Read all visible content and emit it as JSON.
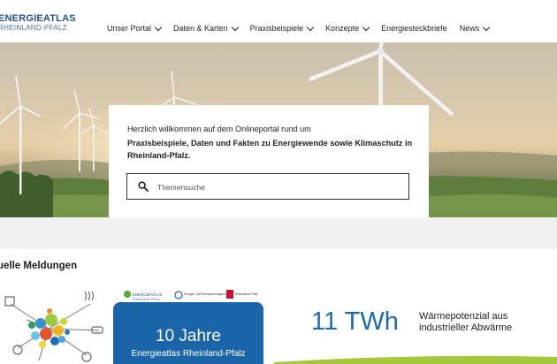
{
  "logo": {
    "line1": "ENERGIEATLAS",
    "line2": "RHEINLAND-PFALZ"
  },
  "nav": [
    {
      "label": "Unser Portal",
      "has_dropdown": true
    },
    {
      "label": "Daten & Karten",
      "has_dropdown": true
    },
    {
      "label": "Praxisbeispiele",
      "has_dropdown": true
    },
    {
      "label": "Konzepte",
      "has_dropdown": true
    },
    {
      "label": "Energiesteckbriefe",
      "has_dropdown": false
    },
    {
      "label": "News",
      "has_dropdown": true
    }
  ],
  "hero": {
    "welcome_line": "Herzlich willkommen auf dem Onlineportal rund um",
    "welcome_bold": "Praxisbeispiele, Daten und Fakten zu Energiewende sowie Klimaschutz in Rheinland-Pfalz.",
    "search": {
      "placeholder": "Themensuche",
      "icon": "search-icon"
    }
  },
  "news": {
    "heading": "uelle Meldungen",
    "cards": [
      {
        "kind": "illustration"
      },
      {
        "kind": "anniversary",
        "title": "10 Jahre",
        "subtitle": "Energieatlas Rheinland-Pfalz",
        "logo_labels": [
          "ENERGIEATLAS",
          "RHEINLAND-PFALZ",
          "Energie- und Klimaschutzagentur",
          "Rheinland-Pfalz"
        ]
      },
      {
        "kind": "figure",
        "value": "11 TWh",
        "description": "Wärmepotenzial aus industrieller Abwärme"
      }
    ]
  },
  "colors": {
    "brand_blue": "#1a64a8",
    "logo_blue": "#2a4f88",
    "accent_green": "#a6c83a"
  }
}
